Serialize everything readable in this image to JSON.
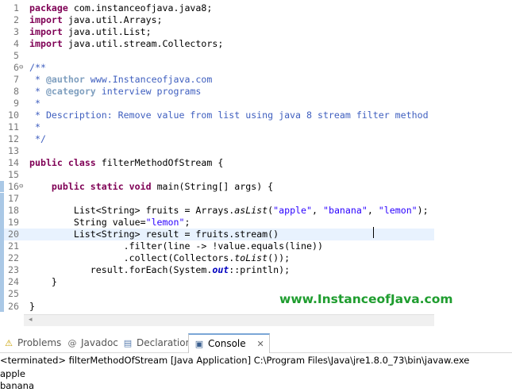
{
  "editor": {
    "lines": [
      {
        "n": "1",
        "fold": "",
        "code": [
          {
            "t": "package",
            "c": "kw"
          },
          {
            "t": " com.instanceofjava.java8;"
          }
        ]
      },
      {
        "n": "2",
        "fold": "",
        "code": [
          {
            "t": "import",
            "c": "kw"
          },
          {
            "t": " java.util.Arrays;"
          }
        ]
      },
      {
        "n": "3",
        "fold": "",
        "code": [
          {
            "t": "import",
            "c": "kw"
          },
          {
            "t": " java.util.List;"
          }
        ]
      },
      {
        "n": "4",
        "fold": "",
        "code": [
          {
            "t": "import",
            "c": "kw"
          },
          {
            "t": " java.util.stream.Collectors;"
          }
        ]
      },
      {
        "n": "5",
        "fold": "",
        "code": []
      },
      {
        "n": "6",
        "fold": "⊖",
        "code": [
          {
            "t": "/**",
            "c": "cm"
          }
        ]
      },
      {
        "n": "7",
        "fold": "",
        "code": [
          {
            "t": " * ",
            "c": "cm"
          },
          {
            "t": "@author",
            "c": "tag"
          },
          {
            "t": " www.Instanceofjava.com",
            "c": "cm"
          }
        ]
      },
      {
        "n": "8",
        "fold": "",
        "code": [
          {
            "t": " * ",
            "c": "cm"
          },
          {
            "t": "@category",
            "c": "tag"
          },
          {
            "t": " interview programs",
            "c": "cm"
          }
        ]
      },
      {
        "n": "9",
        "fold": "",
        "code": [
          {
            "t": " *",
            "c": "cm"
          }
        ]
      },
      {
        "n": "10",
        "fold": "",
        "code": [
          {
            "t": " * Description: Remove value from list using java 8 stream filter method",
            "c": "cm"
          }
        ]
      },
      {
        "n": "11",
        "fold": "",
        "code": [
          {
            "t": " *",
            "c": "cm"
          }
        ]
      },
      {
        "n": "12",
        "fold": "",
        "code": [
          {
            "t": " */",
            "c": "cm"
          }
        ]
      },
      {
        "n": "13",
        "fold": "",
        "code": []
      },
      {
        "n": "14",
        "fold": "",
        "code": [
          {
            "t": "public",
            "c": "kw"
          },
          {
            "t": " "
          },
          {
            "t": "class",
            "c": "kw"
          },
          {
            "t": " filterMethodOfStream {"
          }
        ]
      },
      {
        "n": "15",
        "fold": "",
        "code": []
      },
      {
        "n": "16",
        "fold": "⊖",
        "code": [
          {
            "t": "    "
          },
          {
            "t": "public",
            "c": "kw"
          },
          {
            "t": " "
          },
          {
            "t": "static",
            "c": "kw"
          },
          {
            "t": " "
          },
          {
            "t": "void",
            "c": "kw"
          },
          {
            "t": " main(String[] args) {"
          }
        ]
      },
      {
        "n": "17",
        "fold": "",
        "code": []
      },
      {
        "n": "18",
        "fold": "",
        "code": [
          {
            "t": "        List<String> fruits = Arrays."
          },
          {
            "t": "asList",
            "c": "static"
          },
          {
            "t": "("
          },
          {
            "t": "\"apple\"",
            "c": "str"
          },
          {
            "t": ", "
          },
          {
            "t": "\"banana\"",
            "c": "str"
          },
          {
            "t": ", "
          },
          {
            "t": "\"lemon\"",
            "c": "str"
          },
          {
            "t": ");"
          }
        ]
      },
      {
        "n": "19",
        "fold": "",
        "code": [
          {
            "t": "        String value="
          },
          {
            "t": "\"lemon\"",
            "c": "str"
          },
          {
            "t": ";"
          }
        ]
      },
      {
        "n": "20",
        "fold": "",
        "current": true,
        "code": [
          {
            "t": "        List<String> result = fruits.stream()"
          }
        ]
      },
      {
        "n": "21",
        "fold": "",
        "code": [
          {
            "t": "                 .filter(line -> !value.equals(line))"
          }
        ]
      },
      {
        "n": "22",
        "fold": "",
        "code": [
          {
            "t": "                 .collect(Collectors."
          },
          {
            "t": "toList",
            "c": "static"
          },
          {
            "t": "());"
          }
        ]
      },
      {
        "n": "23",
        "fold": "",
        "code": [
          {
            "t": "           result.forEach(System."
          },
          {
            "t": "out",
            "c": "field"
          },
          {
            "t": "::println);"
          }
        ]
      },
      {
        "n": "24",
        "fold": "",
        "code": [
          {
            "t": "    }"
          }
        ]
      },
      {
        "n": "25",
        "fold": "",
        "code": []
      },
      {
        "n": "26",
        "fold": "",
        "code": [
          {
            "t": "}"
          }
        ]
      }
    ]
  },
  "watermark": "www.InstanceofJava.com",
  "scroll_arrow": "◂",
  "tabs": [
    {
      "label": "Problems",
      "icon": "⚠"
    },
    {
      "label": "Javadoc",
      "icon": "@"
    },
    {
      "label": "Declaration",
      "icon": "▤"
    },
    {
      "label": "Console",
      "icon": "▣"
    }
  ],
  "console_close": "✕",
  "console": {
    "description": "<terminated> filterMethodOfStream [Java Application] C:\\Program Files\\Java\\jre1.8.0_73\\bin\\javaw.exe",
    "output": [
      "apple",
      "banana"
    ]
  },
  "colors": {
    "keyword": "#7f0055",
    "comment": "#3f5fbf",
    "string": "#2a00ff",
    "current_line": "#e8f2fe",
    "watermark": "#1f9d2f"
  }
}
